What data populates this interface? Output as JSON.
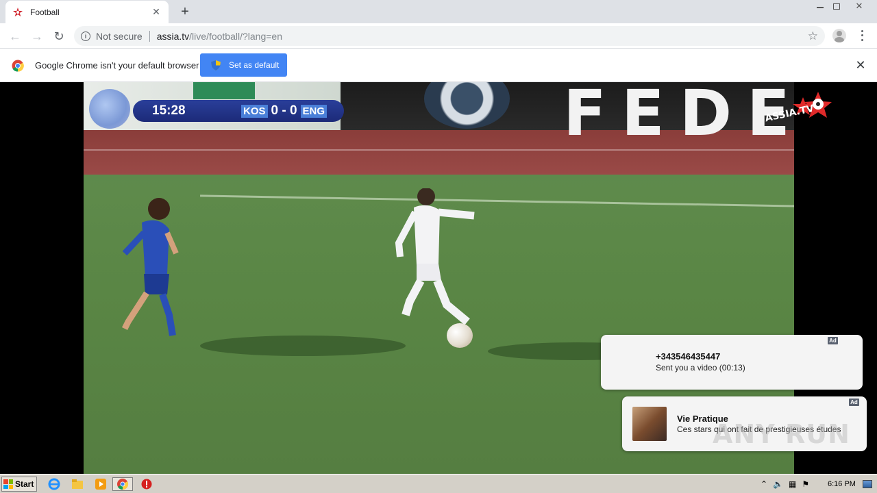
{
  "browser": {
    "tab": {
      "title": "Football"
    },
    "address": {
      "security": "Not secure",
      "host": "assia.tv",
      "path": "/live/football/?lang=en"
    },
    "infobar": {
      "message": "Google Chrome isn't your default browser",
      "button": "Set as default"
    }
  },
  "video": {
    "scorebug": {
      "time": "15:28",
      "home": "KOS",
      "score": "0 - 0",
      "away": "ENG"
    },
    "stadium_text": "FEDE",
    "logo": "ASSIA.TV"
  },
  "notifications": [
    {
      "name": "+343546435447",
      "text": "Sent you a video (00:13)",
      "badge": "Ad"
    },
    {
      "name": "Vie Pratique",
      "text": "Ces stars qui ont fait de prestigieuses études",
      "badge": "Ad"
    }
  ],
  "watermark": "ANY RUN",
  "taskbar": {
    "start": "Start",
    "clock": "6:16 PM"
  },
  "colors": {
    "accent": "#4285f4",
    "scorebug": "#1c2a78",
    "tabstrip": "#dee1e6"
  }
}
